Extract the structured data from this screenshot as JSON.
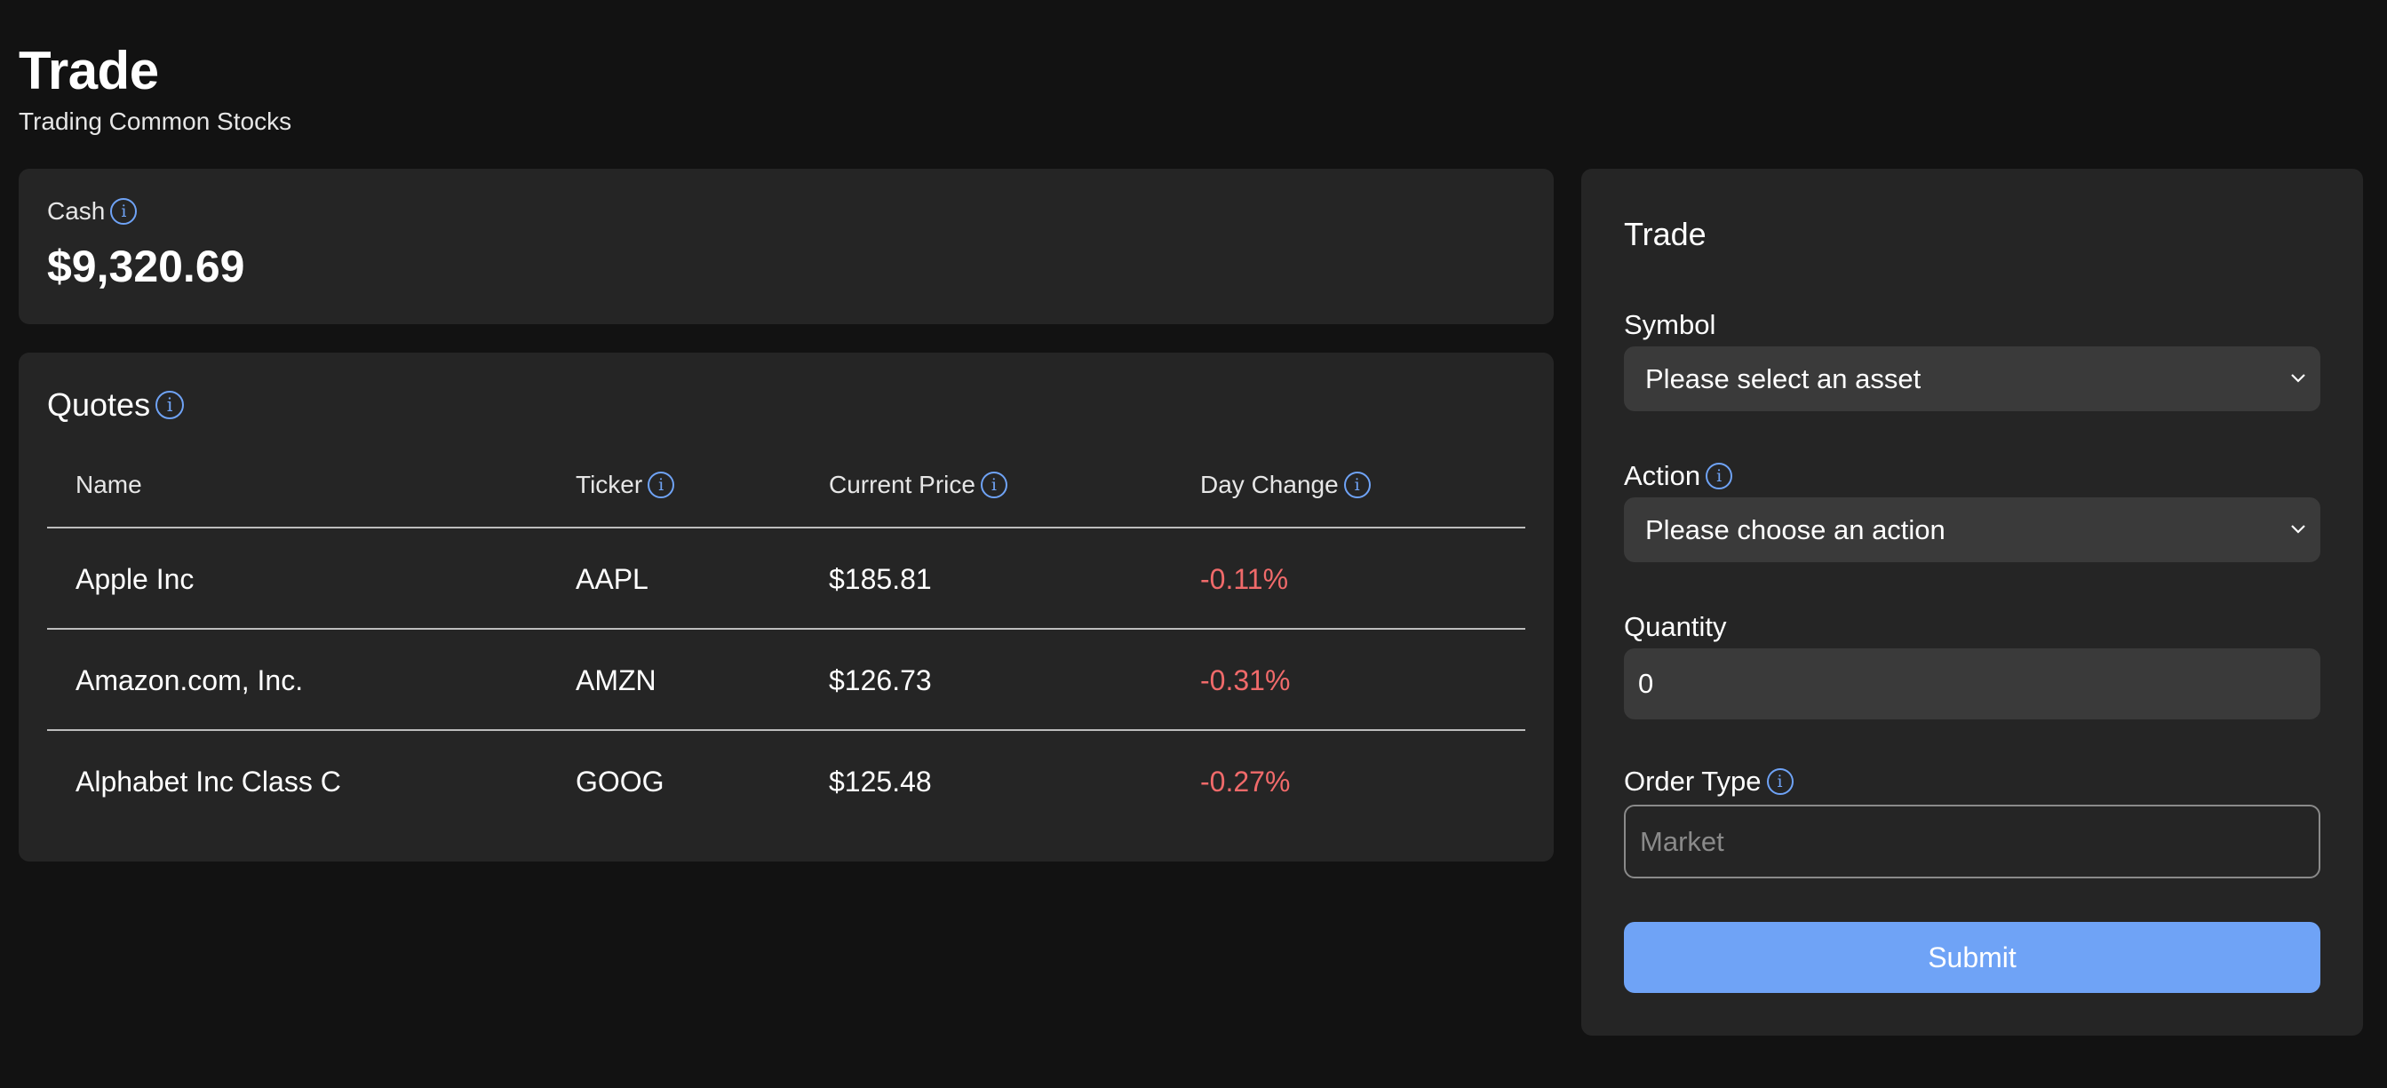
{
  "header": {
    "title": "Trade",
    "subtitle": "Trading Common Stocks"
  },
  "cash": {
    "label": "Cash",
    "value": "$9,320.69",
    "info_icon": "info-icon"
  },
  "quotes": {
    "title": "Quotes",
    "columns": [
      "Name",
      "Ticker",
      "Current Price",
      "Day Change"
    ],
    "rows": [
      {
        "name": "Apple Inc",
        "ticker": "AAPL",
        "price": "$185.81",
        "change": "-0.11%"
      },
      {
        "name": "Amazon.com, Inc.",
        "ticker": "AMZN",
        "price": "$126.73",
        "change": "-0.31%"
      },
      {
        "name": "Alphabet Inc Class C",
        "ticker": "GOOG",
        "price": "$125.48",
        "change": "-0.27%"
      }
    ]
  },
  "trade": {
    "title": "Trade",
    "symbol_label": "Symbol",
    "symbol_value": "Please select an asset",
    "action_label": "Action",
    "action_value": "Please choose an action",
    "quantity_label": "Quantity",
    "quantity_value": "0",
    "order_type_label": "Order Type",
    "order_type_placeholder": "Market",
    "submit_label": "Submit"
  },
  "colors": {
    "background": "#121212",
    "card": "#252525",
    "accent": "#6fa3f6",
    "negative": "#f06a6a"
  }
}
